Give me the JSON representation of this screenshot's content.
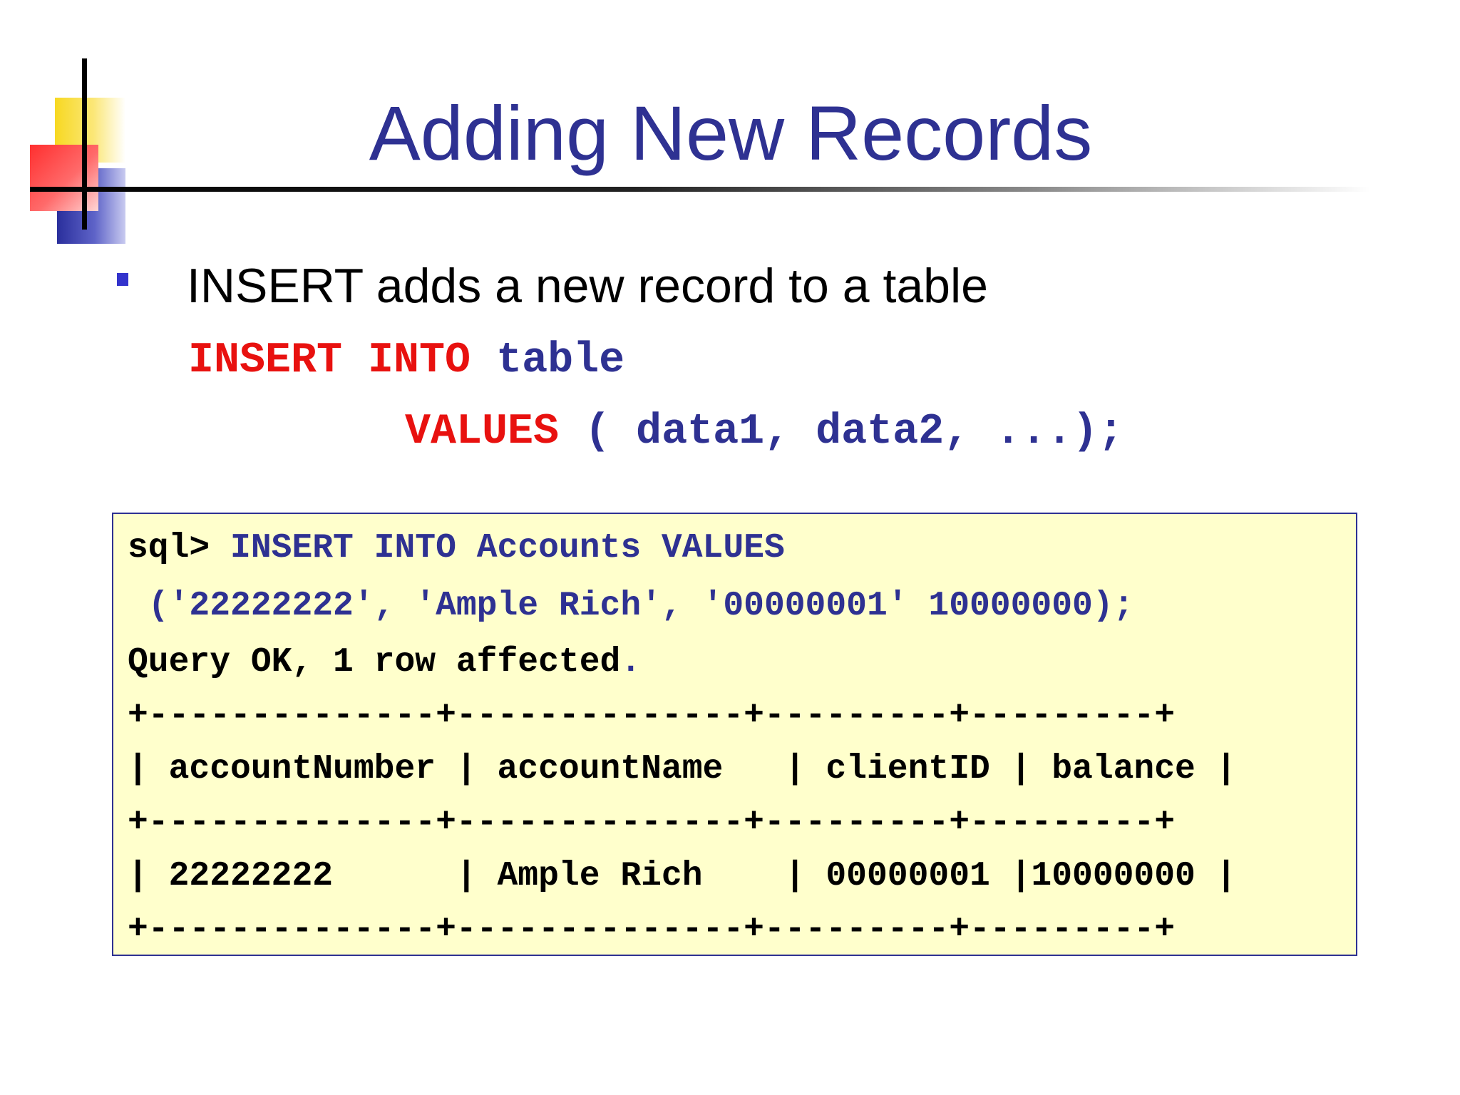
{
  "slide": {
    "title": "Adding New Records",
    "bullet": "INSERT adds a new record to a table"
  },
  "syntax": {
    "line1_keyword": "INSERT INTO ",
    "line1_placeholder": "table",
    "line2_keyword": "VALUES ",
    "line2_placeholder": "( data1, data2, ...);"
  },
  "console": {
    "prompt": "sql> ",
    "command1": "INSERT INTO Accounts VALUES",
    "command2": " ('22222222', 'Ample Rich', '00000001' 10000000);",
    "result_text": "Query OK, 1 row affected",
    "result_period": ".",
    "table_border": "+--------------+--------------+---------+---------+",
    "table_header": "| accountNumber | accountName   | clientID | balance |",
    "table_row": "| 22222222      | Ample Rich    | 00000001 |10000000 |"
  },
  "colors": {
    "title": "#2e3192",
    "keyword": "#e8110f",
    "placeholder": "#2e3192",
    "console_bg": "#ffffcc"
  }
}
